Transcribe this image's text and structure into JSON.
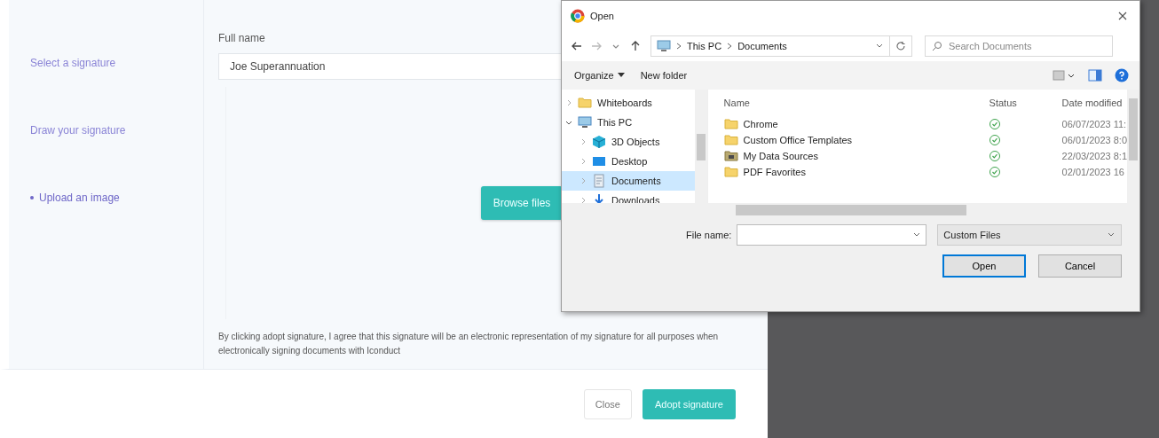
{
  "signature_modal": {
    "nav": [
      {
        "label": "Select a signature",
        "selected": false
      },
      {
        "label": "Draw your signature",
        "selected": false
      },
      {
        "label": "Upload an image",
        "selected": true
      }
    ],
    "full_name": {
      "label": "Full name",
      "value": "Joe Superannuation"
    },
    "upload": {
      "button": "Browse files"
    },
    "disclaimer": "By clicking adopt signature, I agree that this signature will be an electronic representation of my signature for all purposes when electronically signing documents with Iconduct",
    "buttons": [
      {
        "label": "Close",
        "kind": "secondary"
      },
      {
        "label": "Adopt signature",
        "kind": "primary"
      }
    ]
  },
  "open_dialog": {
    "title": "Open",
    "path": [
      "This PC",
      "Documents"
    ],
    "search": {
      "placeholder": "Search Documents"
    },
    "toolbar": [
      {
        "label": "Organize",
        "kind": "menu"
      },
      {
        "label": "New folder",
        "kind": "plain"
      }
    ],
    "tree": [
      {
        "label": "Whiteboards",
        "kind": "folder",
        "expanded": false,
        "selected": false
      },
      {
        "label": "This PC",
        "kind": "pc",
        "expanded": true,
        "selected": false,
        "children": [
          {
            "label": "3D Objects",
            "kind": "objects",
            "expanded": false,
            "selected": false
          },
          {
            "label": "Desktop",
            "kind": "desktop",
            "expanded": false,
            "selected": false
          },
          {
            "label": "Documents",
            "kind": "documents",
            "expanded": false,
            "selected": true
          },
          {
            "label": "Downloads",
            "kind": "downloads",
            "expanded": false,
            "selected": false
          }
        ]
      }
    ],
    "columns": [
      "Name",
      "Status",
      "Date modified"
    ],
    "files": [
      {
        "name": "Chrome",
        "kind": "folder",
        "date": "06/07/2023 11:"
      },
      {
        "name": "Custom Office Templates",
        "kind": "folder",
        "date": "06/01/2023 8:0"
      },
      {
        "name": "My Data Sources",
        "kind": "datasource",
        "date": "22/03/2023 8:1"
      },
      {
        "name": "PDF Favorites",
        "kind": "folder",
        "date": "02/01/2023 16"
      }
    ],
    "file_name": {
      "label": "File name:"
    },
    "file_type": "Custom Files",
    "buttons": [
      {
        "label": "Open",
        "kind": "default"
      },
      {
        "label": "Cancel",
        "kind": "plain"
      }
    ]
  }
}
